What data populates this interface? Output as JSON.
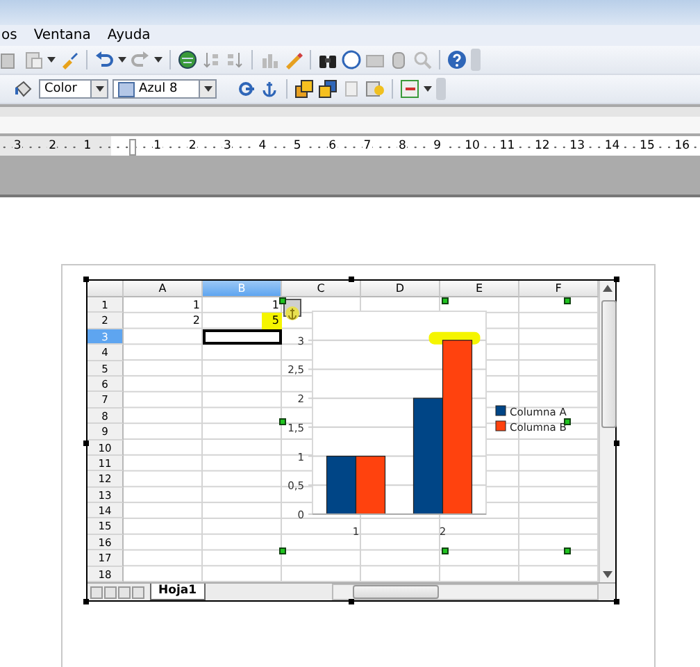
{
  "menu": [
    {
      "label": "os"
    },
    {
      "label": "Ventana"
    },
    {
      "label": "Ayuda"
    }
  ],
  "toolbar": {
    "area_style": "Color",
    "fill_color": "Azul 8"
  },
  "ruler": {
    "left_labels": [
      "3",
      "2",
      "1"
    ],
    "labels": [
      "1",
      "2",
      "3",
      "4",
      "5",
      "6",
      "7",
      "8",
      "9",
      "10",
      "11",
      "12",
      "13",
      "14",
      "15",
      "16"
    ]
  },
  "sheet": {
    "columns": [
      {
        "label": "A",
        "selected": false
      },
      {
        "label": "B",
        "selected": true
      },
      {
        "label": "C",
        "selected": false
      },
      {
        "label": "D",
        "selected": false
      },
      {
        "label": "E",
        "selected": false
      },
      {
        "label": "F",
        "selected": false
      }
    ],
    "rows": [
      {
        "label": "1",
        "selected": false,
        "cells": [
          {
            "text": "1",
            "highlighted": false,
            "active": false
          },
          {
            "text": "1",
            "highlighted": false,
            "active": false
          }
        ]
      },
      {
        "label": "2",
        "selected": false,
        "cells": [
          {
            "text": "2",
            "highlighted": false,
            "active": false
          },
          {
            "text": "5",
            "highlighted": true,
            "active": false
          }
        ]
      },
      {
        "label": "3",
        "selected": true,
        "cells": [
          null,
          {
            "highlighted": false,
            "active": true
          }
        ]
      },
      {
        "label": "4",
        "selected": false
      },
      {
        "label": "5",
        "selected": false
      },
      {
        "label": "6",
        "selected": false
      },
      {
        "label": "7",
        "selected": false
      },
      {
        "label": "8",
        "selected": false
      },
      {
        "label": "9",
        "selected": false
      },
      {
        "label": "10",
        "selected": false
      },
      {
        "label": "11",
        "selected": false
      },
      {
        "label": "12",
        "selected": false
      },
      {
        "label": "13",
        "selected": false
      },
      {
        "label": "14",
        "selected": false
      },
      {
        "label": "15",
        "selected": false
      },
      {
        "label": "16",
        "selected": false
      },
      {
        "label": "17",
        "selected": false
      },
      {
        "label": "18",
        "selected": false
      }
    ],
    "tabs": [
      {
        "label": "Hoja1",
        "selected": true
      }
    ]
  },
  "chart": {
    "selected": true,
    "highlight_last_bar": true,
    "chart_data": {
      "type": "bar",
      "grid": true,
      "legend": true,
      "categories": [
        "1",
        "2"
      ],
      "series": [
        {
          "name": "Columna A",
          "color": "#004586",
          "values": [
            1,
            2
          ]
        },
        {
          "name": "Columna B",
          "color": "#ff420e",
          "values": [
            1,
            3
          ]
        }
      ],
      "ylim": [
        0,
        3.5
      ],
      "yticks": [
        0,
        {
          "value": 0.5,
          "label": "0,5"
        },
        1,
        {
          "value": 1.5,
          "label": "1,5"
        },
        2,
        {
          "value": 2.5,
          "label": "2,5"
        },
        3
      ]
    }
  }
}
